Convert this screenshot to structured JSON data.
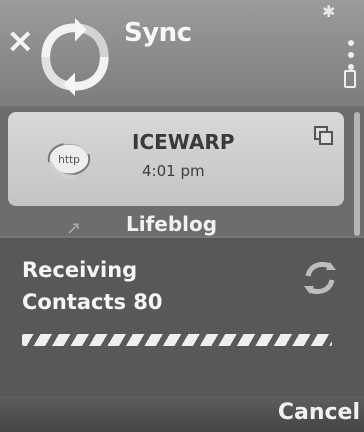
{
  "app": {
    "title": "Sync"
  },
  "list": {
    "items": [
      {
        "title": "ICEWARP",
        "time": "4:01 pm"
      },
      {
        "title": "Lifeblog"
      }
    ]
  },
  "dialog": {
    "line1": "Receiving",
    "line2": "Contacts 80",
    "progress_state": "in progress"
  },
  "softkeys": {
    "right": "Cancel"
  }
}
